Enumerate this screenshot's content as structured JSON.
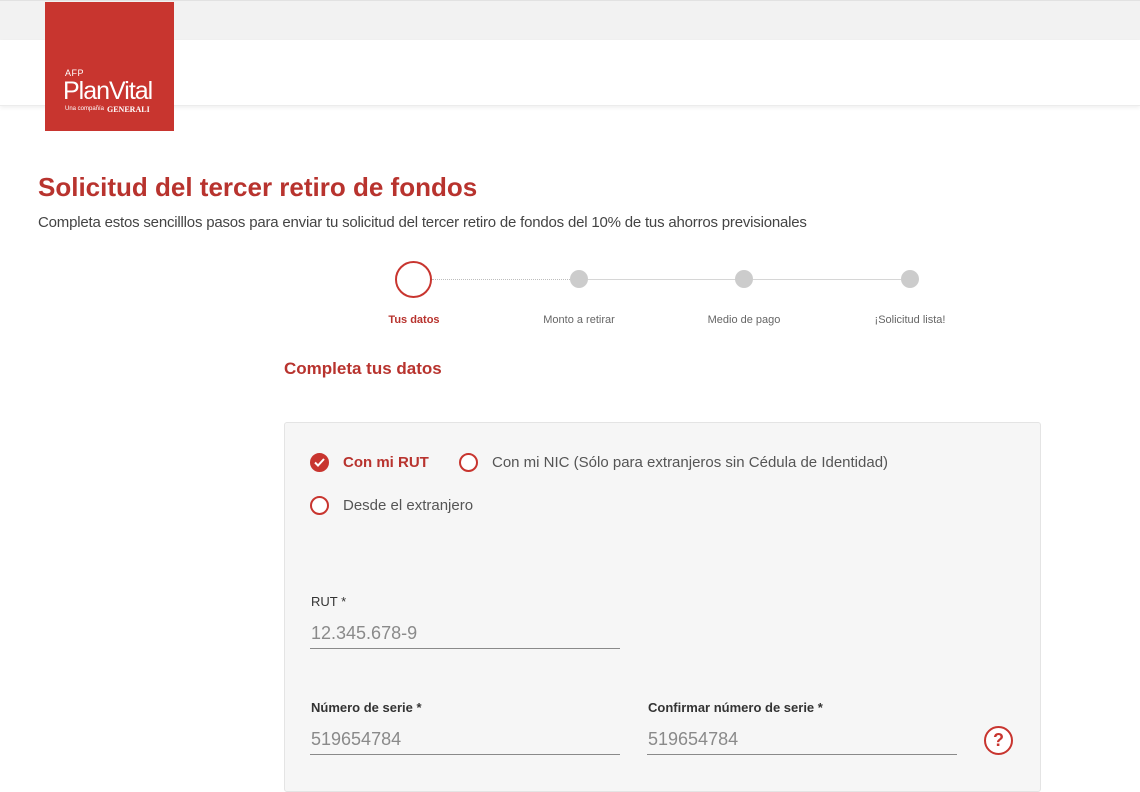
{
  "logo": {
    "afp": "AFP",
    "brand": "PlanVital",
    "tagline": "Una compañía",
    "partner": "GENERALI"
  },
  "header": {
    "title": "Solicitud del tercer retiro de fondos",
    "subtitle": "Completa estos sencilllos pasos para enviar tu solicitud del tercer retiro de fondos del 10% de tus ahorros previsionales"
  },
  "stepper": {
    "steps": [
      {
        "label": "Tus datos"
      },
      {
        "label": "Monto a retirar"
      },
      {
        "label": "Medio de pago"
      },
      {
        "label": "¡Solicitud lista!"
      }
    ]
  },
  "form": {
    "section_title": "Completa tus datos",
    "options": [
      {
        "label": "Con mi RUT"
      },
      {
        "label": "Con mi NIC (Sólo para extranjeros sin Cédula de Identidad)"
      },
      {
        "label": "Desde el extranjero"
      }
    ],
    "rut": {
      "label": "RUT *",
      "placeholder": "12.345.678-9"
    },
    "serie": {
      "label": "Número de serie *",
      "placeholder": "519654784"
    },
    "confirm_serie": {
      "label": "Confirmar número de serie *",
      "placeholder": "519654784"
    },
    "help_symbol": "?"
  },
  "colors": {
    "brand_red": "#c8352f",
    "title_red": "#b8332e",
    "inactive_step": "#cccccc"
  }
}
